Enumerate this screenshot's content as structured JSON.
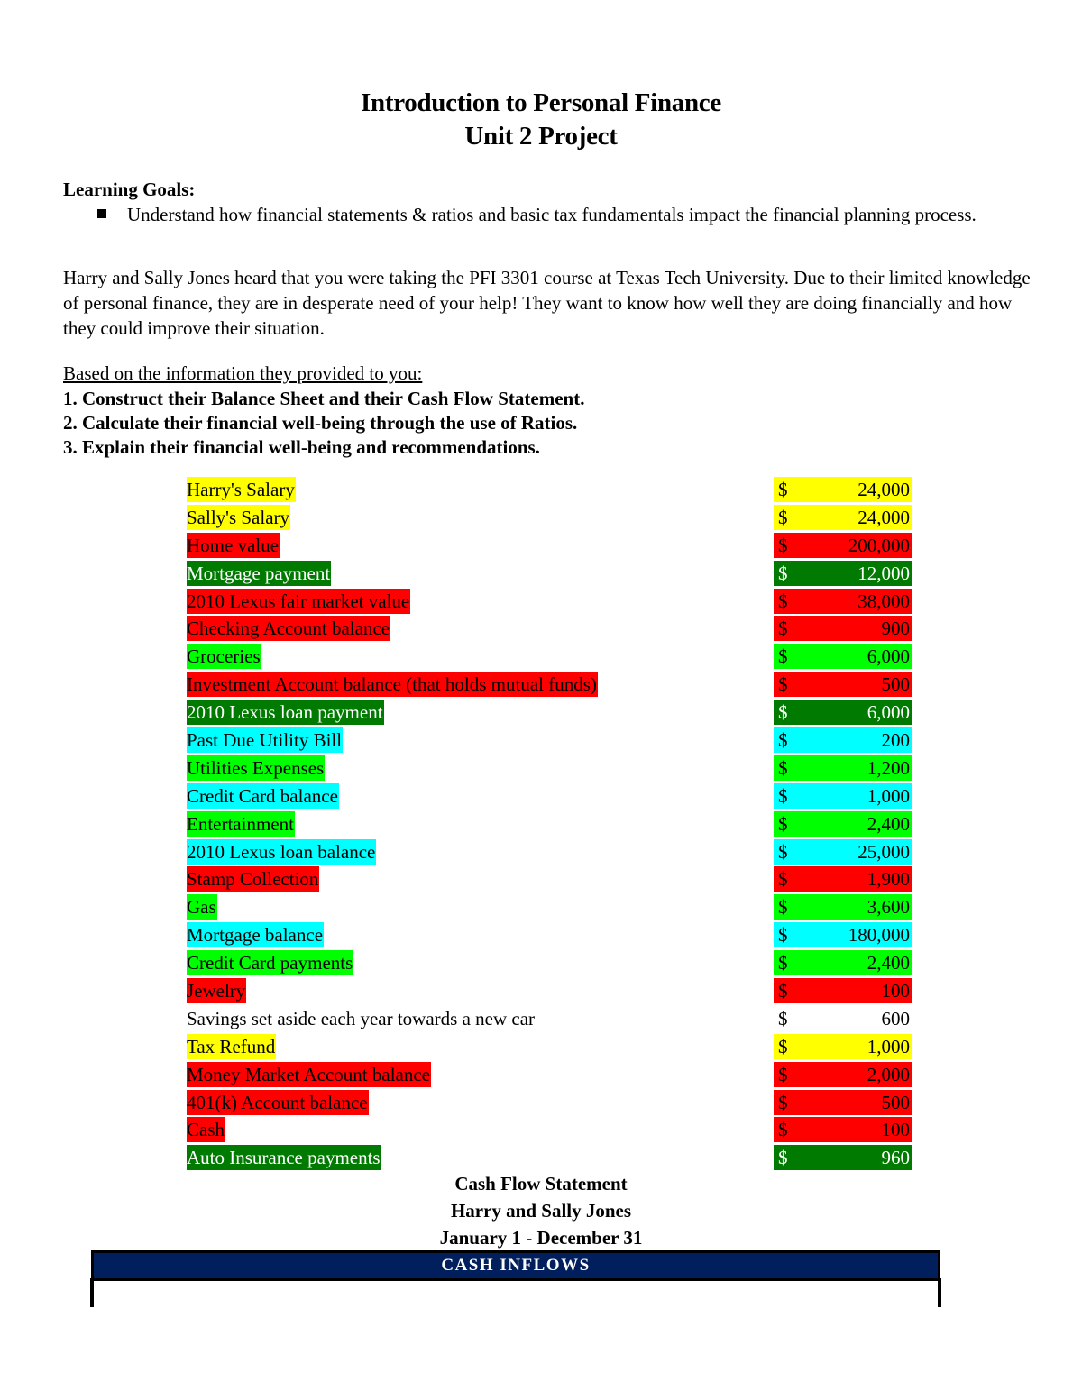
{
  "header": {
    "title_line1": "Introduction to Personal Finance",
    "title_line2": "Unit 2 Project"
  },
  "learning_goals": {
    "label": "Learning Goals:",
    "bullet_icon": "square-bullet",
    "items": [
      "Understand how financial statements & ratios and basic tax fundamentals impact the financial planning process."
    ]
  },
  "intro": "Harry and Sally Jones heard that you were taking the PFI 3301 course at Texas Tech University. Due to their limited knowledge of personal finance, they are in desperate need of your help! They want to know how well they are doing financially and how they could improve their situation.",
  "instructions": {
    "lead": "Based on the information they provided to you:",
    "tasks": [
      "1. Construct their Balance Sheet and their Cash Flow Statement.",
      "2. Calculate their financial well-being through the use of Ratios.",
      "3. Explain their financial well-being and recommendations."
    ]
  },
  "colors": {
    "yellow": "#ffff00",
    "red": "#ff0000",
    "dark_green": "#007a00",
    "bright_green": "#00ff00",
    "cyan": "#00ffff",
    "none": "#ffffff",
    "navy_header": "#001f5c"
  },
  "items": [
    {
      "label": "Harry's Salary",
      "currency": "$",
      "amount": "24,000",
      "color": "yellow"
    },
    {
      "label": "Sally's Salary",
      "currency": "$",
      "amount": "24,000",
      "color": "yellow"
    },
    {
      "label": "Home value",
      "currency": "$",
      "amount": "200,000",
      "color": "red"
    },
    {
      "label": "Mortgage payment",
      "currency": "$",
      "amount": "12,000",
      "color": "dark_green"
    },
    {
      "label": "2010 Lexus fair market value",
      "currency": "$",
      "amount": "38,000",
      "color": "red"
    },
    {
      "label": "Checking Account balance",
      "currency": "$",
      "amount": "900",
      "color": "red"
    },
    {
      "label": "Groceries",
      "currency": "$",
      "amount": "6,000",
      "color": "bright_green"
    },
    {
      "label": "Investment Account balance (that holds mutual funds)",
      "currency": "$",
      "amount": "500",
      "color": "red"
    },
    {
      "label": "2010 Lexus loan payment",
      "currency": "$",
      "amount": "6,000",
      "color": "dark_green"
    },
    {
      "label": "Past Due Utility Bill",
      "currency": "$",
      "amount": "200",
      "color": "cyan"
    },
    {
      "label": "Utilities Expenses",
      "currency": "$",
      "amount": "1,200",
      "color": "bright_green"
    },
    {
      "label": "Credit Card balance",
      "currency": "$",
      "amount": "1,000",
      "color": "cyan"
    },
    {
      "label": "Entertainment",
      "currency": "$",
      "amount": "2,400",
      "color": "bright_green"
    },
    {
      "label": "2010 Lexus loan balance",
      "currency": "$",
      "amount": "25,000",
      "color": "cyan"
    },
    {
      "label": "Stamp Collection",
      "currency": "$",
      "amount": "1,900",
      "color": "red"
    },
    {
      "label": "Gas",
      "currency": "$",
      "amount": "3,600",
      "color": "bright_green"
    },
    {
      "label": "Mortgage balance",
      "currency": "$",
      "amount": "180,000",
      "color": "cyan"
    },
    {
      "label": "Credit Card payments",
      "currency": "$",
      "amount": "2,400",
      "color": "bright_green"
    },
    {
      "label": "Jewelry",
      "currency": "$",
      "amount": "100",
      "color": "red"
    },
    {
      "label": "Savings set aside each year towards a new car",
      "currency": "$",
      "amount": "600",
      "color": "none"
    },
    {
      "label": "Tax Refund",
      "currency": "$",
      "amount": "1,000",
      "color": "yellow"
    },
    {
      "label": "Money Market Account balance",
      "currency": "$",
      "amount": "2,000",
      "color": "red"
    },
    {
      "label": "401(k) Account balance",
      "currency": "$",
      "amount": "500",
      "color": "red"
    },
    {
      "label": "Cash",
      "currency": "$",
      "amount": "100",
      "color": "red"
    },
    {
      "label": "Auto Insurance payments",
      "currency": "$",
      "amount": "960",
      "color": "dark_green"
    }
  ],
  "cash_flow": {
    "title": "Cash Flow Statement",
    "names": "Harry and Sally Jones",
    "period": "January 1 - December 31",
    "section_header": "CASH INFLOWS"
  }
}
